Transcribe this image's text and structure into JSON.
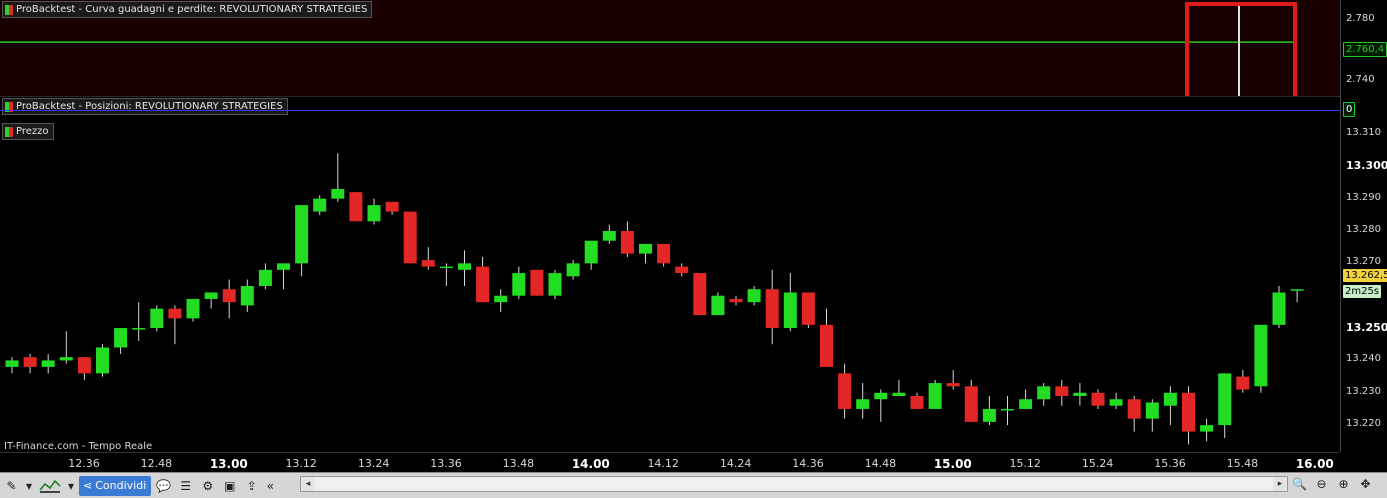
{
  "panes": {
    "equity_title": "ProBacktest - Curva guadagni e perdite: REVOLUTIONARY  STRATEGIES",
    "positions_title": "ProBacktest - Posizioni: REVOLUTIONARY  STRATEGIES",
    "price_title": "Prezzo"
  },
  "equity_axis": {
    "ticks": [
      "2.780",
      "2.740"
    ],
    "current_value": "2.760,4"
  },
  "positions_axis": {
    "current_value": "0"
  },
  "price_axis": {
    "ticks": [
      "13.310",
      "13.300",
      "13.290",
      "13.280",
      "13.270",
      "13.250",
      "13.240",
      "13.230",
      "13.220"
    ],
    "bold_ticks": [
      "13.300",
      "13.250"
    ],
    "current_price": "13.262,5",
    "timer": "2m25s"
  },
  "time_axis": {
    "ticks": [
      "12.36",
      "12.48",
      "13.00",
      "13.12",
      "13.24",
      "13.36",
      "13.48",
      "14.00",
      "14.12",
      "14.24",
      "14.36",
      "14.48",
      "15.00",
      "15.12",
      "15.24",
      "15.36",
      "15.48",
      "16.00"
    ],
    "bold_ticks": [
      "13.00",
      "14.00",
      "15.00",
      "16.00"
    ]
  },
  "source_label": "IT-Finance.com - Tempo Reale",
  "toolbar": {
    "share_label": "Condividi",
    "scroll_left": "«"
  },
  "colors": {
    "up": "#22dd22",
    "down": "#e32626",
    "equity_line": "#22cc22",
    "highlight_box": "#e01b1b",
    "position_line": "#2a3cff"
  },
  "chart_data": {
    "type": "candlestick",
    "interval_note": "",
    "candles": [
      {
        "o": 13238,
        "h": 13241,
        "l": 13236,
        "c": 13240
      },
      {
        "o": 13241,
        "h": 13242,
        "l": 13236,
        "c": 13238
      },
      {
        "o": 13238,
        "h": 13242,
        "l": 13236,
        "c": 13240
      },
      {
        "o": 13240,
        "h": 13249,
        "l": 13239,
        "c": 13241
      },
      {
        "o": 13241,
        "h": 13241,
        "l": 13234,
        "c": 13236
      },
      {
        "o": 13236,
        "h": 13245,
        "l": 13235,
        "c": 13244
      },
      {
        "o": 13244,
        "h": 13250,
        "l": 13242,
        "c": 13250
      },
      {
        "o": 13250,
        "h": 13258,
        "l": 13246,
        "c": 13250
      },
      {
        "o": 13250,
        "h": 13257,
        "l": 13249,
        "c": 13256
      },
      {
        "o": 13256,
        "h": 13257,
        "l": 13245,
        "c": 13253
      },
      {
        "o": 13253,
        "h": 13259,
        "l": 13252,
        "c": 13259
      },
      {
        "o": 13259,
        "h": 13261,
        "l": 13256,
        "c": 13261
      },
      {
        "o": 13262,
        "h": 13265,
        "l": 13253,
        "c": 13258
      },
      {
        "o": 13257,
        "h": 13265,
        "l": 13255,
        "c": 13263
      },
      {
        "o": 13263,
        "h": 13270,
        "l": 13262,
        "c": 13268
      },
      {
        "o": 13268,
        "h": 13270,
        "l": 13262,
        "c": 13270
      },
      {
        "o": 13270,
        "h": 13288,
        "l": 13266,
        "c": 13288
      },
      {
        "o": 13286,
        "h": 13291,
        "l": 13285,
        "c": 13290
      },
      {
        "o": 13290,
        "h": 13304,
        "l": 13289,
        "c": 13293
      },
      {
        "o": 13292,
        "h": 13292,
        "l": 13283,
        "c": 13283
      },
      {
        "o": 13283,
        "h": 13290,
        "l": 13282,
        "c": 13288
      },
      {
        "o": 13289,
        "h": 13289,
        "l": 13285,
        "c": 13286
      },
      {
        "o": 13286,
        "h": 13286,
        "l": 13270,
        "c": 13270
      },
      {
        "o": 13271,
        "h": 13275,
        "l": 13268,
        "c": 13269
      },
      {
        "o": 13269,
        "h": 13270,
        "l": 13263,
        "c": 13269
      },
      {
        "o": 13268,
        "h": 13274,
        "l": 13263,
        "c": 13270
      },
      {
        "o": 13269,
        "h": 13272,
        "l": 13258,
        "c": 13258
      },
      {
        "o": 13258,
        "h": 13262,
        "l": 13255,
        "c": 13260
      },
      {
        "o": 13260,
        "h": 13269,
        "l": 13259,
        "c": 13267
      },
      {
        "o": 13268,
        "h": 13268,
        "l": 13260,
        "c": 13260
      },
      {
        "o": 13260,
        "h": 13268,
        "l": 13259,
        "c": 13267
      },
      {
        "o": 13266,
        "h": 13271,
        "l": 13265,
        "c": 13270
      },
      {
        "o": 13270,
        "h": 13277,
        "l": 13268,
        "c": 13277
      },
      {
        "o": 13277,
        "h": 13282,
        "l": 13276,
        "c": 13280
      },
      {
        "o": 13280,
        "h": 13283,
        "l": 13272,
        "c": 13273
      },
      {
        "o": 13273,
        "h": 13276,
        "l": 13270,
        "c": 13276
      },
      {
        "o": 13276,
        "h": 13276,
        "l": 13269,
        "c": 13270
      },
      {
        "o": 13269,
        "h": 13270,
        "l": 13266,
        "c": 13267
      },
      {
        "o": 13267,
        "h": 13267,
        "l": 13254,
        "c": 13254
      },
      {
        "o": 13254,
        "h": 13261,
        "l": 13254,
        "c": 13260
      },
      {
        "o": 13259,
        "h": 13260,
        "l": 13257,
        "c": 13258
      },
      {
        "o": 13258,
        "h": 13263,
        "l": 13257,
        "c": 13262
      },
      {
        "o": 13262,
        "h": 13268,
        "l": 13245,
        "c": 13250
      },
      {
        "o": 13250,
        "h": 13267,
        "l": 13249,
        "c": 13261
      },
      {
        "o": 13261,
        "h": 13261,
        "l": 13250,
        "c": 13251
      },
      {
        "o": 13251,
        "h": 13256,
        "l": 13238,
        "c": 13238
      },
      {
        "o": 13236,
        "h": 13239,
        "l": 13222,
        "c": 13225
      },
      {
        "o": 13225,
        "h": 13233,
        "l": 13222,
        "c": 13228
      },
      {
        "o": 13228,
        "h": 13231,
        "l": 13221,
        "c": 13230
      },
      {
        "o": 13229,
        "h": 13234,
        "l": 13229,
        "c": 13230
      },
      {
        "o": 13229,
        "h": 13230,
        "l": 13225,
        "c": 13225
      },
      {
        "o": 13225,
        "h": 13234,
        "l": 13225,
        "c": 13233
      },
      {
        "o": 13233,
        "h": 13237,
        "l": 13231,
        "c": 13232
      },
      {
        "o": 13232,
        "h": 13234,
        "l": 13221,
        "c": 13221
      },
      {
        "o": 13221,
        "h": 13229,
        "l": 13220,
        "c": 13225
      },
      {
        "o": 13225,
        "h": 13229,
        "l": 13220,
        "c": 13225
      },
      {
        "o": 13225,
        "h": 13231,
        "l": 13225,
        "c": 13228
      },
      {
        "o": 13228,
        "h": 13233,
        "l": 13226,
        "c": 13232
      },
      {
        "o": 13232,
        "h": 13234,
        "l": 13226,
        "c": 13229
      },
      {
        "o": 13229,
        "h": 13233,
        "l": 13226,
        "c": 13230
      },
      {
        "o": 13230,
        "h": 13231,
        "l": 13225,
        "c": 13226
      },
      {
        "o": 13226,
        "h": 13230,
        "l": 13225,
        "c": 13228
      },
      {
        "o": 13228,
        "h": 13229,
        "l": 13218,
        "c": 13222
      },
      {
        "o": 13222,
        "h": 13228,
        "l": 13218,
        "c": 13227
      },
      {
        "o": 13226,
        "h": 13232,
        "l": 13220,
        "c": 13230
      },
      {
        "o": 13230,
        "h": 13232,
        "l": 13214,
        "c": 13218
      },
      {
        "o": 13218,
        "h": 13222,
        "l": 13215,
        "c": 13220
      },
      {
        "o": 13220,
        "h": 13236,
        "l": 13216,
        "c": 13236
      },
      {
        "o": 13235,
        "h": 13237,
        "l": 13230,
        "c": 13231
      },
      {
        "o": 13232,
        "h": 13240,
        "l": 13230,
        "c": 13251
      },
      {
        "o": 13251,
        "h": 13263,
        "l": 13250,
        "c": 13261
      },
      {
        "o": 13262,
        "h": 13262,
        "l": 13258,
        "c": 13262
      }
    ],
    "ylim": [
      13212,
      13314
    ],
    "equity_ylim": [
      2729,
      2785
    ]
  }
}
